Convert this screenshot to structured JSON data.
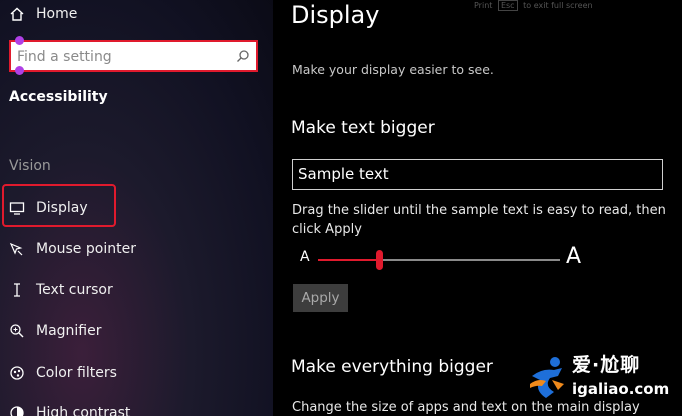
{
  "sidebar": {
    "home": {
      "label": "Home",
      "icon": "home-icon"
    },
    "search": {
      "placeholder": "Find a setting",
      "value": "",
      "icon": "search-icon"
    },
    "section_title": "Accessibility",
    "group_label": "Vision",
    "items": [
      {
        "label": "Display",
        "icon": "monitor-icon",
        "highlighted": true
      },
      {
        "label": "Mouse pointer",
        "icon": "mouse-pointer-icon"
      },
      {
        "label": "Text cursor",
        "icon": "text-cursor-icon"
      },
      {
        "label": "Magnifier",
        "icon": "magnifier-icon"
      },
      {
        "label": "Color filters",
        "icon": "color-filters-icon"
      },
      {
        "label": "High contrast",
        "icon": "high-contrast-icon"
      }
    ]
  },
  "top_ghost": {
    "before": "Print",
    "key": "Esc",
    "after": "to exit full screen"
  },
  "main": {
    "title": "Display",
    "subtitle": "Make your display easier to see.",
    "text_bigger": {
      "heading": "Make text bigger",
      "sample": "Sample text",
      "instruction": "Drag the slider until the sample text is easy to read, then click Apply",
      "slider_small_label": "A",
      "slider_large_label": "A",
      "slider_fraction": 0.25,
      "apply_label": "Apply"
    },
    "everything_bigger": {
      "heading": "Make everything bigger",
      "description": "Change the size of apps and text on the main display"
    }
  },
  "watermark": {
    "chinese": "爱·尬聊",
    "url": "igaliao.com"
  },
  "colors": {
    "accent_red": "#e01a2d",
    "cursor_purple": "#b040e6",
    "sidebar_bg": "#15152a"
  }
}
